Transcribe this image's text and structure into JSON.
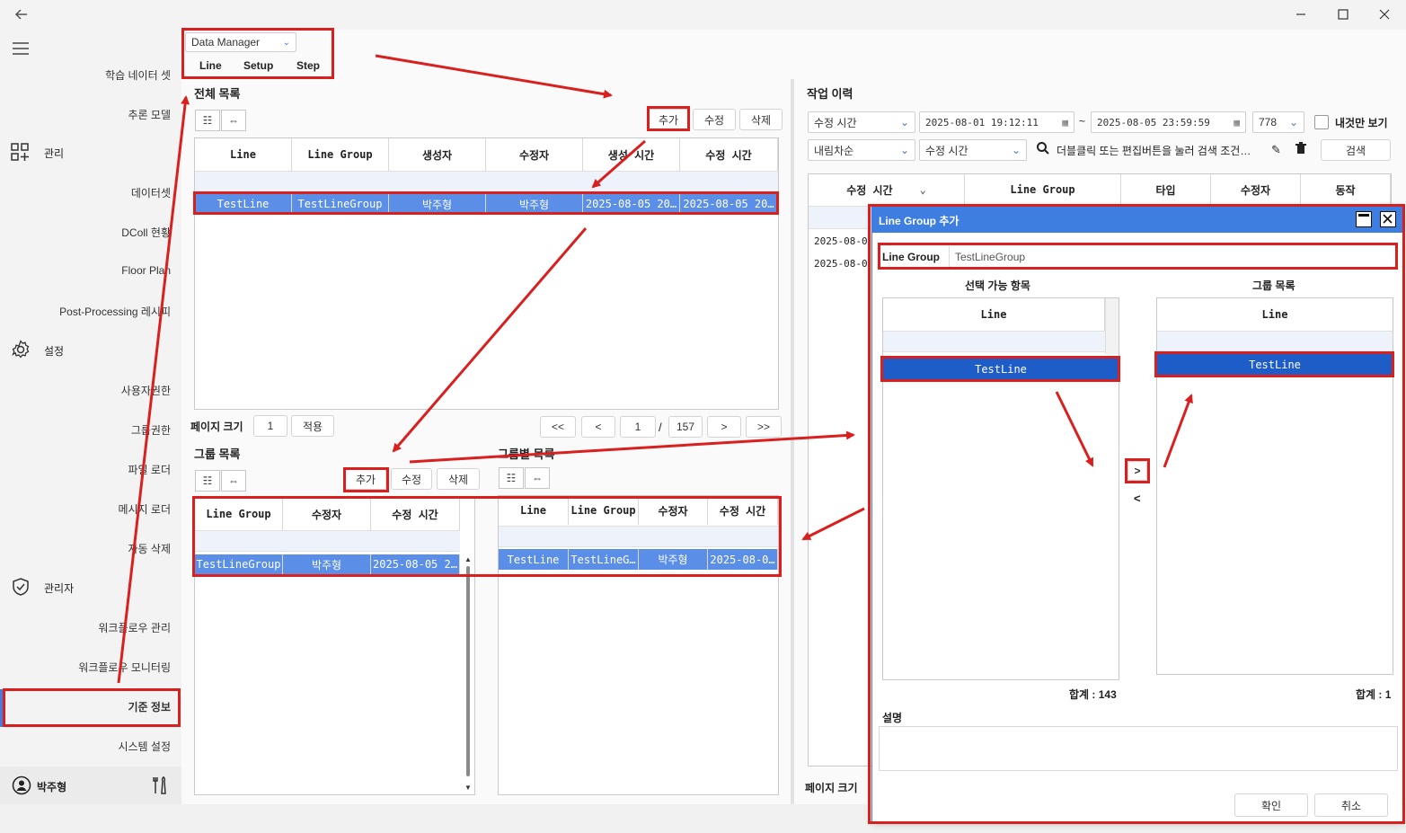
{
  "window": {
    "back_icon": "arrow-left-icon",
    "minimize_icon": "minimize-icon",
    "maximize_icon": "maximize-icon",
    "close_icon": "close-icon"
  },
  "sidebar": {
    "menu_icon": "hamburger-icon",
    "items": [
      {
        "label": "학습 네이터 셋"
      },
      {
        "label": "추론 모델"
      },
      {
        "label": "관리",
        "icon": "apps-add-icon",
        "section": true
      },
      {
        "label": "데이터셋"
      },
      {
        "label": "DColl 현황"
      },
      {
        "label": "Floor Plan"
      },
      {
        "label": "Post-Processing 레시피"
      },
      {
        "label": "설정",
        "icon": "gear-icon",
        "section": true
      },
      {
        "label": "사용자권한"
      },
      {
        "label": "그룹권한"
      },
      {
        "label": "파일 로더"
      },
      {
        "label": "메시지 로더"
      },
      {
        "label": "자동 삭제"
      },
      {
        "label": "관리자",
        "icon": "shield-icon",
        "section": true
      },
      {
        "label": "워크플로우 관리"
      },
      {
        "label": "워크플로우 모니터링"
      },
      {
        "label": "기준 정보",
        "active": true
      },
      {
        "label": "시스템 설정"
      }
    ],
    "user_name": "박주형",
    "user_icon": "user-circle-icon",
    "tools_icon": "tools-icon"
  },
  "toolbar": {
    "dropdown_value": "Data Manager",
    "tabs": [
      "Line",
      "Setup",
      "Step"
    ]
  },
  "all_list": {
    "title": "전체 목록",
    "add": "추가",
    "edit": "수정",
    "delete": "삭제",
    "columns": [
      "Line",
      "Line Group",
      "생성자",
      "수정자",
      "생성 시간",
      "수정 시간"
    ],
    "rows": [
      [
        "TestLine",
        "TestLineGroup",
        "박주형",
        "박주형",
        "2025-08-05 20…",
        "2025-08-05 20…"
      ]
    ],
    "page_size_label": "페이지 크기",
    "page_size": "1",
    "apply": "적용",
    "first": "<<",
    "prev": "<",
    "page": "1",
    "sep": "/",
    "total": "157",
    "next": ">",
    "last": ">>"
  },
  "group_list": {
    "title": "그룹 목록",
    "add": "추가",
    "edit": "수정",
    "delete": "삭제",
    "columns": [
      "Line Group",
      "수정자",
      "수정 시간"
    ],
    "rows": [
      [
        "TestLineGroup",
        "박주형",
        "2025-08-05 2…"
      ]
    ]
  },
  "group_detail": {
    "title": "그룹별 목록",
    "columns": [
      "Line",
      "Line Group",
      "수정자",
      "수정 시간"
    ],
    "rows": [
      [
        "TestLine",
        "TestLineG…",
        "박주형",
        "2025-08-0…"
      ]
    ]
  },
  "history": {
    "title": "작업 이력",
    "sort_field": "수정 시간",
    "date_from": "2025-08-01  19:12:11",
    "tilde": "~",
    "date_to": "2025-08-05  23:59:59",
    "count": "778",
    "mine_only": "내것만 보기",
    "order": "내림차순",
    "order_field": "수정 시간",
    "search_hint": "더블클릭 또는 편집버튼을 눌러 검색 조건…",
    "search_btn": "검색",
    "columns": [
      "수정 시간",
      "Line Group",
      "타입",
      "수정자",
      "동작"
    ],
    "rows": [
      "2025-08-0",
      "2025-08-0"
    ],
    "page_size_label": "페이지 크기"
  },
  "dialog": {
    "title": "Line Group 추가",
    "field_label": "Line Group",
    "field_value": "TestLineGroup",
    "available_title": "선택 가능 항목",
    "group_title": "그룹 목록",
    "col": "Line",
    "available_rows": [
      "TestLine"
    ],
    "group_rows": [
      "TestLine"
    ],
    "move_right": ">",
    "move_left": "<",
    "available_total": "합계 : 143",
    "group_total": "합계 : 1",
    "desc_label": "설명",
    "ok": "확인",
    "cancel": "취소"
  },
  "colors": {
    "accent": "#3d7ee0",
    "selected": "#5b8ee6",
    "selected_dark": "#1e5dc8",
    "highlight": "#d9201f"
  }
}
